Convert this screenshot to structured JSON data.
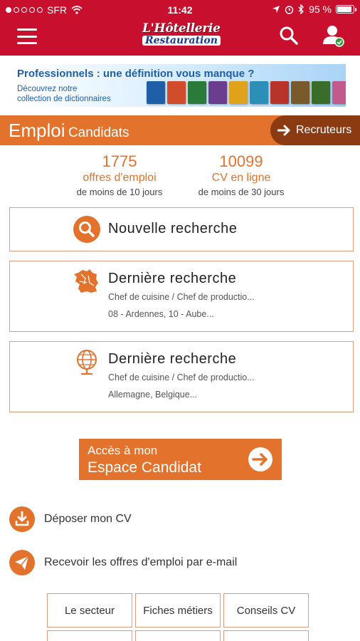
{
  "status_bar": {
    "carrier": "SFR",
    "time": "11:42",
    "battery": "95 %",
    "battery_level": 0.95,
    "signal_bars_filled": 1,
    "signal_bars_total": 5
  },
  "header": {
    "logo_line1": "L'Hôtellerie",
    "logo_line2": "Restauration",
    "menu_icon": "hamburger-icon",
    "search_icon": "search-icon",
    "user_icon": "user-icon",
    "background": "#c8102e"
  },
  "banner": {
    "headline": "Professionnels : une définition vous manque ?",
    "sub_line1": "Découvrez notre",
    "sub_line2": "collection de dictionnaires",
    "book_colors": [
      "#1f5fa8",
      "#d14c2b",
      "#2a7a3a",
      "#6a3d8f",
      "#e0a21a",
      "#2b8fb8",
      "#b8332a",
      "#7a5a2a",
      "#3b6d2a",
      "#c25a8c"
    ]
  },
  "section": {
    "title_big": "Emploi",
    "title_small": "Candidats",
    "recruteurs_label": "Recruteurs",
    "accent": "#e2722c",
    "dark_accent": "#8c3a12"
  },
  "stats": [
    {
      "number": "1775",
      "label": "offres d'emploi",
      "period": "de moins de 10 jours"
    },
    {
      "number": "10099",
      "label": "CV en ligne",
      "period": "de moins de 30 jours"
    }
  ],
  "new_search": {
    "label": "Nouvelle recherche",
    "icon": "search-icon"
  },
  "last_searches": [
    {
      "title": "Dernière recherche",
      "jobs": "Chef de cuisine / Chef de productio...",
      "places": "08 - Ardennes, 10 - Aube...",
      "icon": "france-map-icon"
    },
    {
      "title": "Dernière recherche",
      "jobs": "Chef de cuisine / Chef de productio...",
      "places": "Allemagne, Belgique...",
      "icon": "globe-icon"
    }
  ],
  "cta": {
    "line1": "Accès à mon",
    "line2": "Espace Candidat",
    "icon": "arrow-right-icon"
  },
  "links": [
    {
      "label": "Déposer mon CV",
      "icon": "download-icon"
    },
    {
      "label": "Recevoir les offres d'emploi par e-mail",
      "icon": "paper-plane-icon"
    }
  ],
  "grid": [
    "Le secteur",
    "Fiches métiers",
    "Conseils CV"
  ]
}
